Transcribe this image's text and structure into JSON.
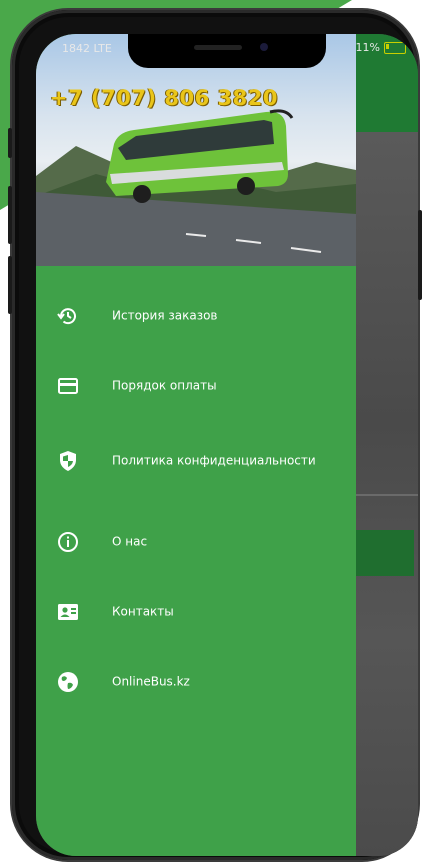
{
  "status": {
    "left": "1842 LTE",
    "battery": "11%"
  },
  "drawer": {
    "phone": "+7 (707) 806 3820",
    "items": [
      {
        "label": "История заказов",
        "icon": "history-icon"
      },
      {
        "label": "Порядок оплаты",
        "icon": "payment-card-icon"
      },
      {
        "label": "Политика конфиденциальности",
        "icon": "shield-icon"
      },
      {
        "label": "О нас",
        "icon": "info-icon"
      },
      {
        "label": "Контакты",
        "icon": "contacts-icon"
      },
      {
        "label": "OnlineBus.kz",
        "icon": "globe-icon"
      }
    ]
  },
  "colors": {
    "drawer": "#3fa149",
    "phone_text": "#e9c51a",
    "accent_dark": "#1f7a33",
    "corner": "#4aa84a"
  }
}
